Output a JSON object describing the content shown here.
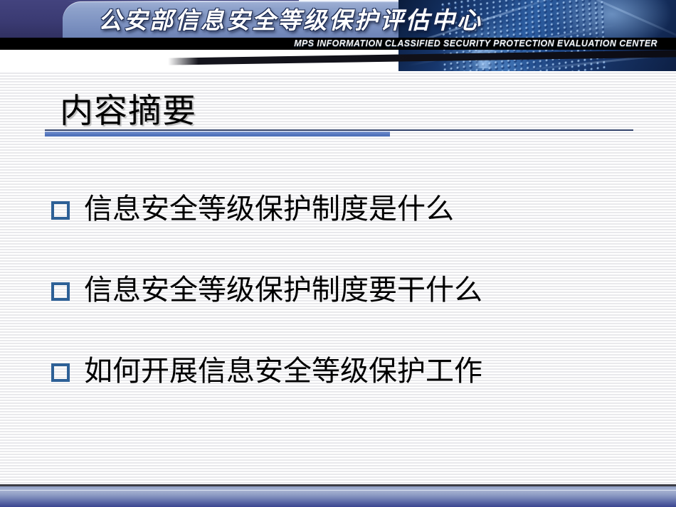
{
  "slide": {
    "title": "内容摘要",
    "banner": {
      "org_name_cn": "公安部信息安全等级保护评估中心",
      "org_name_en": "MPS  INFORMATION  CLASSIFIED  SECURITY  PROTECTION  EVALUATION  CENTER"
    },
    "bullets": [
      {
        "marker": "hollow-square",
        "text": "信息安全等级保护制度是什么"
      },
      {
        "marker": "hollow-square",
        "text": "信息安全等级保护制度要干什么"
      },
      {
        "marker": "hollow-square",
        "text": "如何开展信息安全等级保护工作"
      }
    ],
    "colors": {
      "banner_navy": "#3a3a72",
      "banner_plaque_blue": "#7e93c2",
      "band_black": "#000000",
      "bullet_blue": "#2d6096",
      "rule_dark": "#32426a",
      "rule_blue": "#5b7cc2",
      "footer_blue": "#3b4590",
      "text_black": "#000000",
      "stripe_gray": "#e9e9ec"
    }
  }
}
